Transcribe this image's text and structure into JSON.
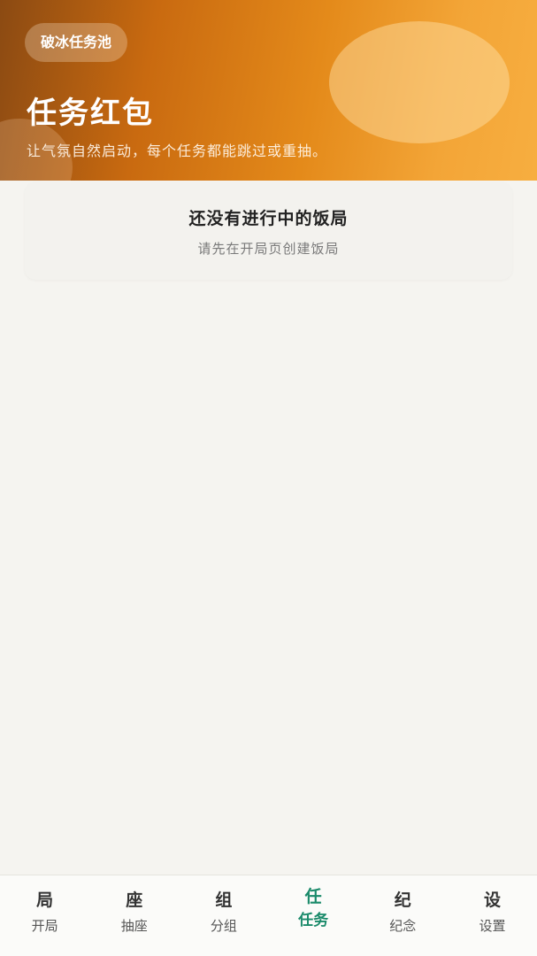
{
  "hero": {
    "chip": "破冰任务池",
    "title": "任务红包",
    "subtitle": "让气氛自然启动，每个任务都能跳过或重抽。"
  },
  "empty_state": {
    "title": "还没有进行中的饭局",
    "description": "请先在开局页创建饭局"
  },
  "tabbar": {
    "items": [
      {
        "icon": "局",
        "label": "开局"
      },
      {
        "icon": "座",
        "label": "抽座"
      },
      {
        "icon": "组",
        "label": "分组"
      },
      {
        "icon": "任",
        "label": "任务"
      },
      {
        "icon": "纪",
        "label": "纪念"
      },
      {
        "icon": "设",
        "label": "设置"
      }
    ],
    "active_index": 3
  },
  "colors": {
    "accent": "#1a8a6a",
    "hero_start": "#8b4a12",
    "hero_end": "#f7ae40",
    "background": "#f5f4f0"
  }
}
